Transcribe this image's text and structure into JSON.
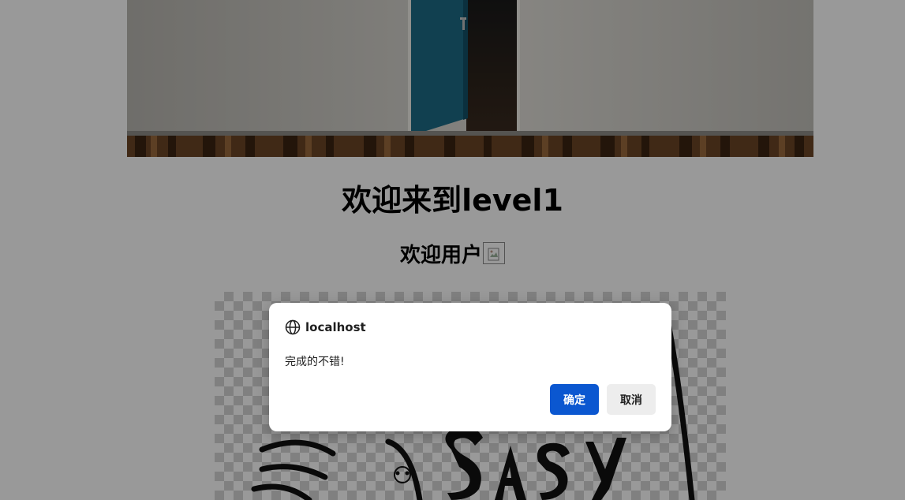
{
  "page": {
    "title": "欢迎来到level1",
    "subtitle": "欢迎用户",
    "broken_image_icon": "broken-image-icon"
  },
  "hero": {
    "description_icon": "door-room-image",
    "door_color": "#1d6b86"
  },
  "easy_image": {
    "text": "easy"
  },
  "dialog": {
    "origin": "localhost",
    "origin_icon": "globe-icon",
    "message": "完成的不错!",
    "ok_label": "确定",
    "cancel_label": "取消",
    "ok_color": "#0b57d0",
    "cancel_color": "#ededed"
  }
}
